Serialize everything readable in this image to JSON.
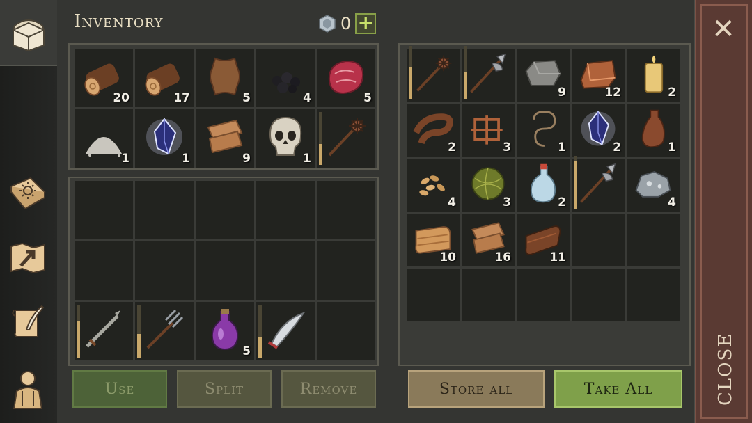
{
  "header": {
    "title": "Inventory",
    "currency_count": "0",
    "currency_icon": "gem-icon",
    "add_label": "+"
  },
  "sidebar": {
    "tabs": [
      {
        "icon": "chest-icon",
        "active": true
      },
      {
        "icon": "sun-book-icon",
        "active": false
      },
      {
        "icon": "map-arrow-icon",
        "active": false
      },
      {
        "icon": "scroll-quill-icon",
        "active": false
      },
      {
        "icon": "character-icon",
        "active": false
      }
    ]
  },
  "inventory": {
    "resources": [
      {
        "name": "log",
        "icon": "log-icon",
        "qty": "20"
      },
      {
        "name": "log",
        "icon": "log-icon",
        "qty": "17"
      },
      {
        "name": "leather hide",
        "icon": "hide-icon",
        "qty": "5"
      },
      {
        "name": "coal",
        "icon": "coal-icon",
        "qty": "4"
      },
      {
        "name": "raw meat",
        "icon": "meat-icon",
        "qty": "5"
      },
      {
        "name": "salt",
        "icon": "salt-icon",
        "qty": "1"
      },
      {
        "name": "crystal",
        "icon": "crystal-icon",
        "qty": "1"
      },
      {
        "name": "cloth",
        "icon": "cloth-icon",
        "qty": "9"
      },
      {
        "name": "skull",
        "icon": "skull-icon",
        "qty": "1"
      },
      {
        "name": "mace",
        "icon": "mace-icon",
        "qty": "",
        "durability": 0.4
      }
    ],
    "equipment": [
      {
        "name": "sword",
        "icon": "sword-icon",
        "qty": "",
        "durability": 0.7
      },
      {
        "name": "pitchfork",
        "icon": "pitchfork-icon",
        "qty": "",
        "durability": 0.45
      },
      {
        "name": "potion",
        "icon": "potion-icon",
        "qty": "5"
      },
      {
        "name": "scimitar",
        "icon": "scimitar-icon",
        "qty": "",
        "durability": 0.4
      },
      {
        "name": "",
        "icon": "",
        "qty": ""
      }
    ]
  },
  "storage": {
    "items": [
      {
        "name": "mace",
        "icon": "mace-icon",
        "qty": "",
        "durability": 0.6
      },
      {
        "name": "halberd",
        "icon": "halberd-icon",
        "qty": "",
        "durability": 0.5
      },
      {
        "name": "stone",
        "icon": "stone-icon",
        "qty": "9"
      },
      {
        "name": "copper ingot",
        "icon": "ingot-icon",
        "qty": "12"
      },
      {
        "name": "candle",
        "icon": "candle-icon",
        "qty": "2"
      },
      {
        "name": "leather strap",
        "icon": "strap-icon",
        "qty": "2"
      },
      {
        "name": "copper wire",
        "icon": "wire-icon",
        "qty": "3"
      },
      {
        "name": "rope",
        "icon": "rope-icon",
        "qty": "1"
      },
      {
        "name": "crystal",
        "icon": "crystal-icon",
        "qty": "2"
      },
      {
        "name": "flask",
        "icon": "flask-icon",
        "qty": "1"
      },
      {
        "name": "seeds",
        "icon": "seeds-icon",
        "qty": "4"
      },
      {
        "name": "hay ball",
        "icon": "hay-icon",
        "qty": "3"
      },
      {
        "name": "water bottle",
        "icon": "bottle-icon",
        "qty": "2"
      },
      {
        "name": "halberd",
        "icon": "halberd-icon",
        "qty": "",
        "durability": 0.9
      },
      {
        "name": "iron ore",
        "icon": "ore-icon",
        "qty": "4"
      },
      {
        "name": "cloth roll",
        "icon": "cloth-roll-icon",
        "qty": "10"
      },
      {
        "name": "cloth",
        "icon": "cloth-icon",
        "qty": "16"
      },
      {
        "name": "leather roll",
        "icon": "leather-roll-icon",
        "qty": "11"
      }
    ]
  },
  "buttons": {
    "use": "Use",
    "split": "Split",
    "remove": "Remove",
    "store_all": "Store all",
    "take_all": "Take All",
    "close": "CLOSE"
  },
  "colors": {
    "background": "#343532",
    "accent_green": "#7fa04a",
    "text": "#e9dfc4",
    "durability": "#c9a86a"
  }
}
